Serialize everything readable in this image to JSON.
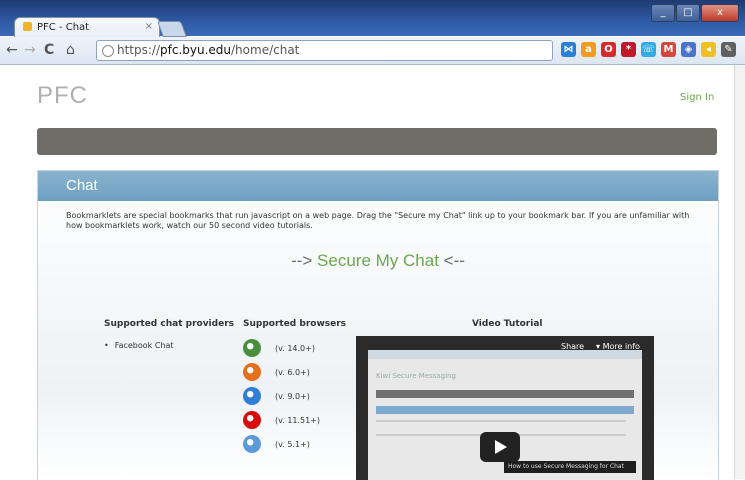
{
  "browser": {
    "tab_title": "PFC - Chat",
    "tab_close": "×",
    "url_scheme": "https://",
    "url_host": "pfc.byu.edu",
    "url_path": "/home/chat",
    "back": "←",
    "forward": "→",
    "reload": "C",
    "home": "⌂",
    "window_minimize": "_",
    "window_maximize": "□",
    "window_close": "x",
    "extensions": [
      {
        "name": "delicious-icon",
        "color": "#2a7fd4",
        "glyph": "⋈"
      },
      {
        "name": "amazon-icon",
        "color": "#f39b1f",
        "glyph": "a"
      },
      {
        "name": "opera-icon",
        "color": "#d82a2a",
        "glyph": "O"
      },
      {
        "name": "lastpass-icon",
        "color": "#c0182a",
        "glyph": "*"
      },
      {
        "name": "skype-icon",
        "color": "#35a9e2",
        "glyph": "☏"
      },
      {
        "name": "gmail-icon",
        "color": "#d9463c",
        "glyph": "M"
      },
      {
        "name": "chat-icon",
        "color": "#4a74c9",
        "glyph": "◈"
      },
      {
        "name": "plug-icon",
        "color": "#f0c022",
        "glyph": "◂"
      },
      {
        "name": "wrench-icon",
        "color": "#606060",
        "glyph": "✎"
      }
    ]
  },
  "site": {
    "logo": "PFC",
    "sign_in": "Sign In"
  },
  "panel": {
    "title": "Chat",
    "intro": "Bookmarklets are special bookmarks that run javascript on a web page. Drag the \"Secure my Chat\" link up to your bookmark bar. If you are unfamiliar with how bookmarklets work, watch our 50 second video tutorials.",
    "secure_prefix": "--> ",
    "secure_link": "Secure My Chat",
    "secure_suffix": " <--",
    "providers_title": "Supported chat providers",
    "providers": [
      "Facebook Chat"
    ],
    "browsers_title": "Supported browsers",
    "browsers": [
      {
        "name": "chrome-icon",
        "version": "(v. 14.0+)",
        "color": "#4b8d3f"
      },
      {
        "name": "firefox-icon",
        "version": "(v. 6.0+)",
        "color": "#e46f1d"
      },
      {
        "name": "ie-icon",
        "version": "(v. 9.0+)",
        "color": "#2f7ed8"
      },
      {
        "name": "opera-icon",
        "version": "(v. 11.51+)",
        "color": "#d60d0d"
      },
      {
        "name": "safari-icon",
        "version": "(v. 5.1+)",
        "color": "#5b9ad9"
      }
    ],
    "video_title": "Video Tutorial",
    "video": {
      "share": "Share",
      "more_info": "More info",
      "inner_title": "Kiwi Secure Messaging",
      "caption": "How to use Secure Messaging for Chat"
    }
  }
}
